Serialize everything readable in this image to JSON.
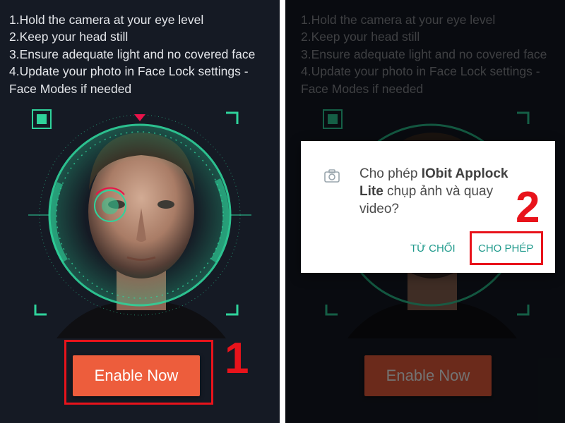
{
  "instructions": [
    "1.Hold the camera at your eye level",
    "2.Keep your head still",
    "3.Ensure adequate light and no covered face",
    "4.Update your photo in Face Lock settings -",
    "Face Modes if needed"
  ],
  "enable_button_label": "Enable Now",
  "step_numbers": [
    "1",
    "2"
  ],
  "dialog": {
    "message_prefix": "Cho phép ",
    "app_name": "IObit Applock Lite",
    "message_suffix": " chụp ảnh và quay video?",
    "deny_label": "TỪ CHỐI",
    "allow_label": "CHO PHÉP",
    "icon": "camera-icon"
  },
  "colors": {
    "background": "#151a24",
    "accent_green": "#2fd39b",
    "button": "#ed5d3c",
    "highlight": "#e8131b",
    "dialog_button_text": "#1f9a8c"
  }
}
